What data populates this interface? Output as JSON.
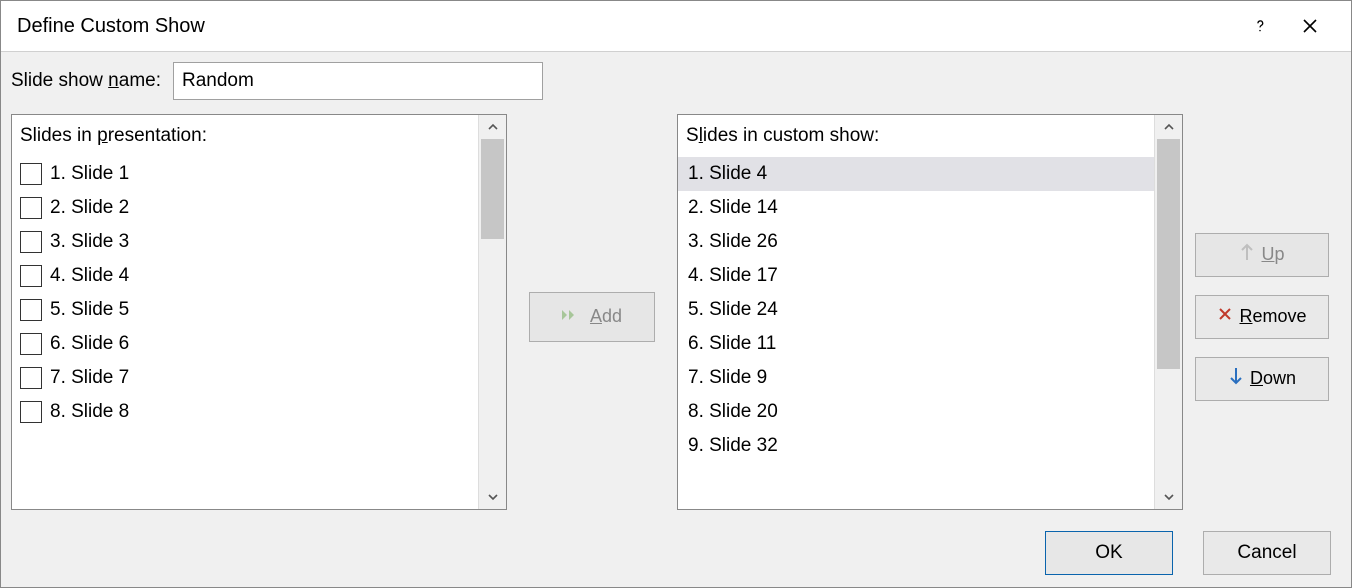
{
  "dialog": {
    "title": "Define Custom Show"
  },
  "name_row": {
    "label_prefix": "Slide show ",
    "label_underline": "n",
    "label_suffix": "ame:",
    "value": "Random"
  },
  "left_list": {
    "header_prefix": "Slides in ",
    "header_underline": "p",
    "header_suffix": "resentation:",
    "items": [
      {
        "label": "1. Slide 1",
        "checked": false
      },
      {
        "label": "2. Slide 2",
        "checked": false
      },
      {
        "label": "3. Slide 3",
        "checked": false
      },
      {
        "label": "4. Slide 4",
        "checked": false
      },
      {
        "label": "5. Slide 5",
        "checked": false
      },
      {
        "label": "6. Slide 6",
        "checked": false
      },
      {
        "label": "7. Slide 7",
        "checked": false
      },
      {
        "label": "8. Slide 8",
        "checked": false
      }
    ]
  },
  "right_list": {
    "header_prefix": "S",
    "header_underline": "l",
    "header_suffix": "ides in custom show:",
    "items": [
      {
        "label": "1. Slide 4",
        "selected": true
      },
      {
        "label": "2. Slide 14",
        "selected": false
      },
      {
        "label": "3. Slide 26",
        "selected": false
      },
      {
        "label": "4. Slide 17",
        "selected": false
      },
      {
        "label": "5. Slide 24",
        "selected": false
      },
      {
        "label": "6. Slide 11",
        "selected": false
      },
      {
        "label": "7. Slide 9",
        "selected": false
      },
      {
        "label": "8. Slide 20",
        "selected": false
      },
      {
        "label": "9. Slide 32",
        "selected": false
      }
    ]
  },
  "buttons": {
    "add_underline": "A",
    "add_suffix": "dd",
    "up_underline": "U",
    "up_suffix": "p",
    "remove_underline": "R",
    "remove_suffix": "emove",
    "down_underline": "D",
    "down_suffix": "own",
    "ok": "OK",
    "cancel": "Cancel"
  }
}
